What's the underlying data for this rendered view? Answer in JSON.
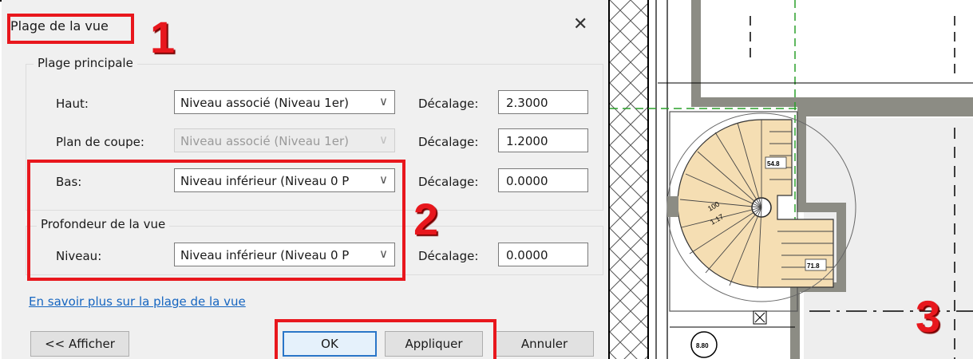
{
  "dialog": {
    "title": "Plage de la vue",
    "close_glyph": "✕",
    "main_range": {
      "group_title": "Plage principale",
      "rows": [
        {
          "label": "Haut:",
          "combo": "Niveau associé (Niveau 1er)",
          "offset_label": "Décalage:",
          "offset": "2.3000",
          "enabled": true
        },
        {
          "label": "Plan de coupe:",
          "combo": "Niveau associé (Niveau 1er)",
          "offset_label": "Décalage:",
          "offset": "1.2000",
          "enabled": false
        },
        {
          "label": "Bas:",
          "combo": "Niveau inférieur (Niveau 0 P",
          "offset_label": "Décalage:",
          "offset": "0.0000",
          "enabled": true
        }
      ]
    },
    "view_depth": {
      "group_title": "Profondeur de la vue",
      "label": "Niveau:",
      "combo": "Niveau inférieur (Niveau 0 P",
      "offset_label": "Décalage:",
      "offset": "0.0000"
    },
    "help_link": "En savoir plus sur la plage de la vue",
    "buttons": {
      "show": "<< Afficher",
      "ok": "OK",
      "apply": "Appliquer",
      "cancel": "Annuler"
    },
    "combo_arrow_icon": "chevron-down-icon"
  },
  "annotations": {
    "color": "#e8171d",
    "marker_1": "1",
    "marker_2": "2",
    "marker_3": "3"
  },
  "drawing": {
    "room_labels": [
      "54.8",
      "71.8",
      "8.80"
    ],
    "stair_labels": [
      "1.17",
      "100"
    ],
    "colors": {
      "wall": "#8c8c84",
      "stair": "#f5deb3",
      "floor": "#eeeeee",
      "guide": "#2aa02a"
    }
  }
}
